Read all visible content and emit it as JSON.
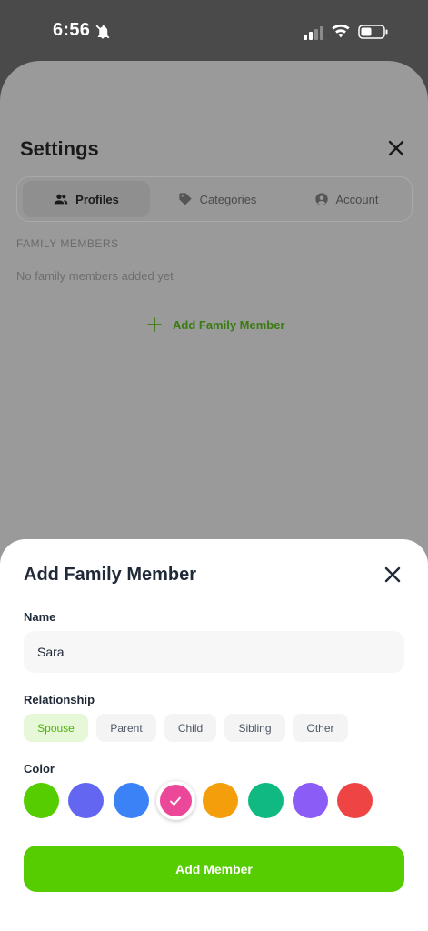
{
  "status_bar": {
    "time": "6:56"
  },
  "settings": {
    "title": "Settings",
    "tabs": [
      {
        "label": "Profiles",
        "icon": "users-icon",
        "active": true
      },
      {
        "label": "Categories",
        "icon": "tag-icon",
        "active": false
      },
      {
        "label": "Account",
        "icon": "account-circle-icon",
        "active": false
      }
    ],
    "section_label": "FAMILY MEMBERS",
    "empty_text": "No family members added yet",
    "add_link_label": "Add Family Member"
  },
  "modal": {
    "title": "Add Family Member",
    "name_label": "Name",
    "name_value": "Sara",
    "relationship_label": "Relationship",
    "relationships": [
      {
        "label": "Spouse",
        "selected": true
      },
      {
        "label": "Parent",
        "selected": false
      },
      {
        "label": "Child",
        "selected": false
      },
      {
        "label": "Sibling",
        "selected": false
      },
      {
        "label": "Other",
        "selected": false
      }
    ],
    "color_label": "Color",
    "colors": [
      "#55cd01",
      "#6366f1",
      "#3b82f6",
      "#ec4899",
      "#f59e0b",
      "#10b981",
      "#8b5cf6",
      "#ef4444"
    ],
    "selected_color_index": 3,
    "submit_label": "Add Member"
  },
  "theme": {
    "accent": "#55cd01",
    "accent_dark": "#3a7a12",
    "chip_selected_bg": "#e7f8d9",
    "chip_selected_text": "#4db30d"
  }
}
